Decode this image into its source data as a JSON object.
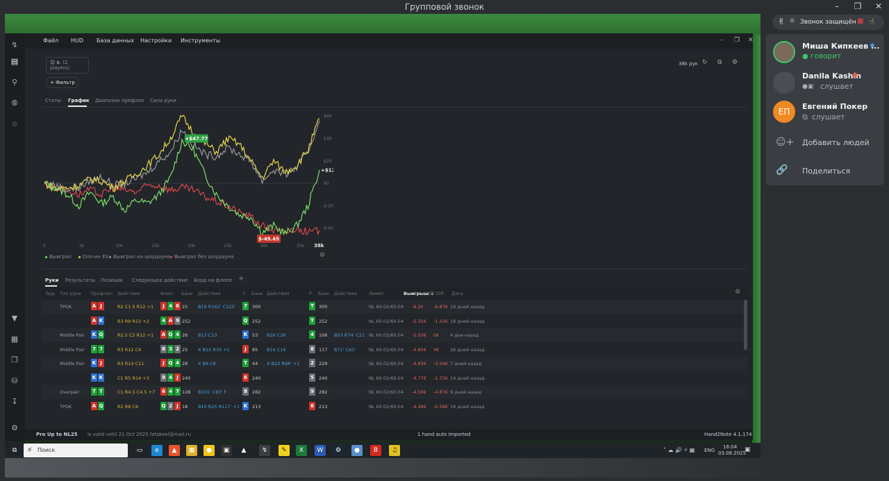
{
  "window": {
    "title": "Групповой звонок"
  },
  "banner": {
    "text": "Звонок защищён"
  },
  "participants": [
    {
      "name": "Миша Кипкеев ...",
      "status": "говорит",
      "initials": ""
    },
    {
      "name": "Danila Kashin",
      "status": "слушает",
      "initials": ""
    },
    {
      "name": "Евгений Покер",
      "status": "слушает",
      "initials": "ЕП"
    }
  ],
  "actions": {
    "add": "Добавить людей",
    "share": "Поделиться"
  },
  "app": {
    "menu": [
      "Файл",
      "HUD",
      "База данных",
      "Настройки",
      "Инструменты"
    ],
    "players_chip": "(2 players)",
    "filter_label": "+ Фильтр",
    "bankroll": "38k рук",
    "tabs": [
      "Статы",
      "График",
      "Диапазон префлоп",
      "Сила руки"
    ],
    "lower_tabs": [
      "Руки",
      "Результаты",
      "Позиции",
      "Следующее действие",
      "Борд на флопе"
    ],
    "columns": [
      "Tags",
      "Тип руки",
      "Префлоп",
      "Действия",
      "Флоп",
      "Банк",
      "Действия",
      "Т.",
      "Банк",
      "Действия",
      "Р.",
      "Банк",
      "Действия",
      "Лимит",
      "Выигрыш ↓",
      "EV Diff",
      "Дата"
    ],
    "status_left_bold": "Pro Up to NL25",
    "status_left": "is valid until 21 Oct 2025",
    "status_email": "fetskeel@mail.ru",
    "status_center": "1 hand auto imported",
    "status_right": "Hand2Note 4.1.174"
  },
  "chart_data": {
    "type": "line",
    "xlabel": "",
    "ylabel": "",
    "x_ticks": [
      "0",
      "5k",
      "10k",
      "15k",
      "20k",
      "25k",
      "30k",
      "35k",
      "38k"
    ],
    "y_ticks": [
      "$60",
      "$40",
      "$20",
      "$0",
      "$-20",
      "$-40"
    ],
    "ylim": [
      -52,
      62
    ],
    "xlim": [
      0,
      38000
    ],
    "annotations": [
      {
        "text": "+$47.77",
        "x": 21000,
        "y": 40
      },
      {
        "text": "+$12.22",
        "x": 38000,
        "y": 12.22
      },
      {
        "text": "$-49.45",
        "x": 31000,
        "y": -49.45
      }
    ],
    "series": [
      {
        "name": "Выиграл",
        "color": "#7ee06a",
        "values": [
          0,
          -4,
          -10,
          -20,
          -8,
          -18,
          -12,
          -24,
          -15,
          -18,
          -10,
          5,
          38,
          30,
          8,
          -10,
          -20,
          -28,
          -30,
          -44,
          -38,
          -45,
          -38,
          -20,
          12
        ]
      },
      {
        "name": "Олл-ин EV",
        "color": "#e8d84a",
        "values": [
          0,
          -5,
          -4,
          -2,
          4,
          2,
          -4,
          2,
          8,
          16,
          26,
          40,
          60,
          45,
          36,
          28,
          40,
          35,
          20,
          5,
          20,
          10,
          16,
          30,
          58
        ]
      },
      {
        "name": "Выиграл на шоудауне",
        "color": "#9a9a9a",
        "values": [
          0,
          -2,
          -6,
          -4,
          2,
          6,
          -2,
          0,
          4,
          10,
          20,
          28,
          48,
          34,
          26,
          24,
          32,
          26,
          20,
          2,
          12,
          8,
          14,
          28,
          56
        ]
      },
      {
        "name": "Выиграл без шоудауна",
        "color": "#d84a4a",
        "values": [
          0,
          -4,
          -6,
          -10,
          -6,
          -10,
          -4,
          -6,
          -8,
          -2,
          -2,
          -6,
          -4,
          -6,
          -12,
          -16,
          -20,
          -26,
          -30,
          -38,
          -42,
          -44,
          -40,
          -44,
          -42
        ]
      }
    ]
  },
  "hands": [
    {
      "type": "TPGK",
      "pre": [
        "A",
        "J"
      ],
      "pre_act": "R2 C1.5 R12 +1",
      "flop": [
        "J",
        "4",
        "6"
      ],
      "fbank": "25",
      "f_act": "B19 R162' C125'",
      "turn": "7",
      "tbank": "300",
      "t_act": "",
      "river": "T",
      "rbank": "300",
      "r_act": "",
      "limit": "NL 60.02/60.04",
      "win": "-6.2€",
      "ev": "-6.87€",
      "date": "19 дней назад"
    },
    {
      "type": "",
      "pre": [
        "A",
        "K"
      ],
      "pre_act": "R3 R9 R22 +2",
      "flop": [
        "4",
        "A",
        "9"
      ],
      "fbank": "252",
      "f_act": "",
      "turn": "Q",
      "tbank": "252",
      "t_act": "",
      "river": "T",
      "rbank": "252",
      "r_act": "",
      "limit": "NL 60.02/60.04",
      "win": "-5.25€",
      "ev": "-1.22€",
      "date": "18 дней назад"
    },
    {
      "type": "Middle Pair",
      "pre": [
        "K",
        "Q"
      ],
      "pre_act": "R2.5 C2 R12 +1",
      "flop": [
        "A",
        "Q",
        "4"
      ],
      "fbank": "26",
      "f_act": "B13 C13",
      "turn": "K",
      "tbank": "53",
      "t_act": "B26 C26",
      "river": "4",
      "rbank": "106",
      "r_act": "B53 R74' C21",
      "limit": "NL 60.02/60.04",
      "win": "-5.02€",
      "ev": "0€",
      "date": "4 дня назад"
    },
    {
      "type": "Middle Pair",
      "pre": [
        "7",
        "7"
      ],
      "pre_act": "R3 R12 C9",
      "flop": [
        "8",
        "3",
        "2"
      ],
      "fbank": "25",
      "f_act": "X B15 R30 +1",
      "turn": "J",
      "tbank": "85",
      "t_act": "B16 C16",
      "river": "8",
      "rbank": "117",
      "r_act": "B71' C63'",
      "limit": "NL 60.02/60.04",
      "win": "-4.85€",
      "ev": "0€",
      "date": "26 дней назад"
    },
    {
      "type": "Middle Pair",
      "pre": [
        "K",
        "J"
      ],
      "pre_act": "R3 R14 C11",
      "flop": [
        "J",
        "Q",
        "4"
      ],
      "fbank": "28",
      "f_act": "X B8 C8",
      "turn": "T",
      "tbank": "44",
      "t_act": "X B22 R98' +1",
      "river": "2",
      "rbank": "229",
      "r_act": "",
      "limit": "NL 60.02/60.04",
      "win": "-4.83€",
      "ev": "-3.54€",
      "date": "7 дней назад"
    },
    {
      "type": "",
      "pre": [
        "K",
        "K"
      ],
      "pre_act": "C1 R5 R14 +3",
      "flop": [
        "9",
        "4",
        "J"
      ],
      "fbank": "240",
      "f_act": "",
      "turn": "6",
      "tbank": "240",
      "t_act": "",
      "river": "5",
      "rbank": "240",
      "r_act": "",
      "limit": "NL 60.02/60.04",
      "win": "-4.77€",
      "ev": "-1.73€",
      "date": "14 дней назад"
    },
    {
      "type": "Overpair",
      "pre": [
        "T",
        "T"
      ],
      "pre_act": "C1 R4.5 C4.5 +7",
      "flop": [
        "6",
        "4",
        "7"
      ],
      "fbank": "128",
      "f_act": "B101' C83' F",
      "turn": "8",
      "tbank": "282",
      "t_act": "",
      "river": "9",
      "rbank": "282",
      "r_act": "",
      "limit": "NL 60.02/60.04",
      "win": "-4.59€",
      "ev": "-4.87€",
      "date": "9 дней назад"
    },
    {
      "type": "TPGK",
      "pre": [
        "A",
        "Q"
      ],
      "pre_act": "R2 R8 C6",
      "flop": [
        "Q",
        "2",
        "J"
      ],
      "fbank": "18",
      "f_act": "B10 R25 R117' +1",
      "turn": "K",
      "tbank": "213",
      "t_act": "",
      "river": "6",
      "rbank": "213",
      "r_act": "",
      "limit": "NL 60.02/60.04",
      "win": "-4.49€",
      "ev": "-0.58€",
      "date": "18 дней назад"
    }
  ],
  "taskbar": {
    "search_placeholder": "Поиск",
    "lang": "ENG",
    "time": "16:04",
    "date": "03.08.2025"
  }
}
